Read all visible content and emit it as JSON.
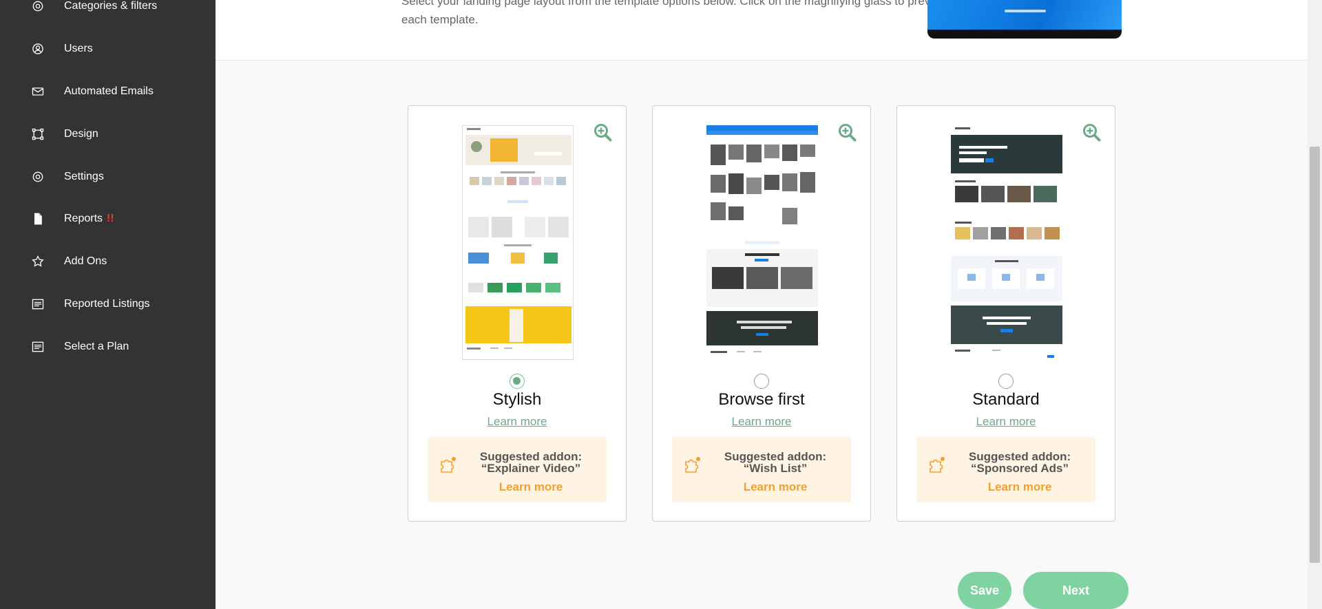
{
  "sidebar": {
    "items": [
      {
        "label": "Categories & filters",
        "icon": "gear-icon"
      },
      {
        "label": "Users",
        "icon": "user-circle-icon"
      },
      {
        "label": "Automated Emails",
        "icon": "envelope-icon"
      },
      {
        "label": "Design",
        "icon": "design-square-icon"
      },
      {
        "label": "Settings",
        "icon": "gear-icon"
      },
      {
        "label": "Reports",
        "icon": "document-icon",
        "badge": "!!"
      },
      {
        "label": "Add Ons",
        "icon": "star-icon"
      },
      {
        "label": "Reported Listings",
        "icon": "list-icon"
      },
      {
        "label": "Select a Plan",
        "icon": "list-icon"
      }
    ]
  },
  "intro": {
    "text": "Select your landing page layout from the template options below. Click on the magnifying glass to preview each template."
  },
  "templates": [
    {
      "name": "Stylish",
      "learn_more": "Learn more",
      "selected": true,
      "addon_title": "Suggested addon:",
      "addon_name": "“Explainer Video”",
      "addon_learn": "Learn more"
    },
    {
      "name": "Browse first",
      "learn_more": "Learn more",
      "selected": false,
      "addon_title": "Suggested addon:",
      "addon_name": "“Wish List”",
      "addon_learn": "Learn more"
    },
    {
      "name": "Standard",
      "learn_more": "Learn more",
      "selected": false,
      "addon_title": "Suggested addon:",
      "addon_name": "“Sponsored Ads”",
      "addon_learn": "Learn more"
    }
  ],
  "actions": {
    "save_label": "Save",
    "next_label": "Next"
  },
  "colors": {
    "sidebar_bg": "#333333",
    "accent_green": "#7fd3a0",
    "link_green": "#6aab87",
    "addon_orange": "#f0a030",
    "addon_bg": "#fff4e3",
    "alert_red": "#e53935"
  }
}
